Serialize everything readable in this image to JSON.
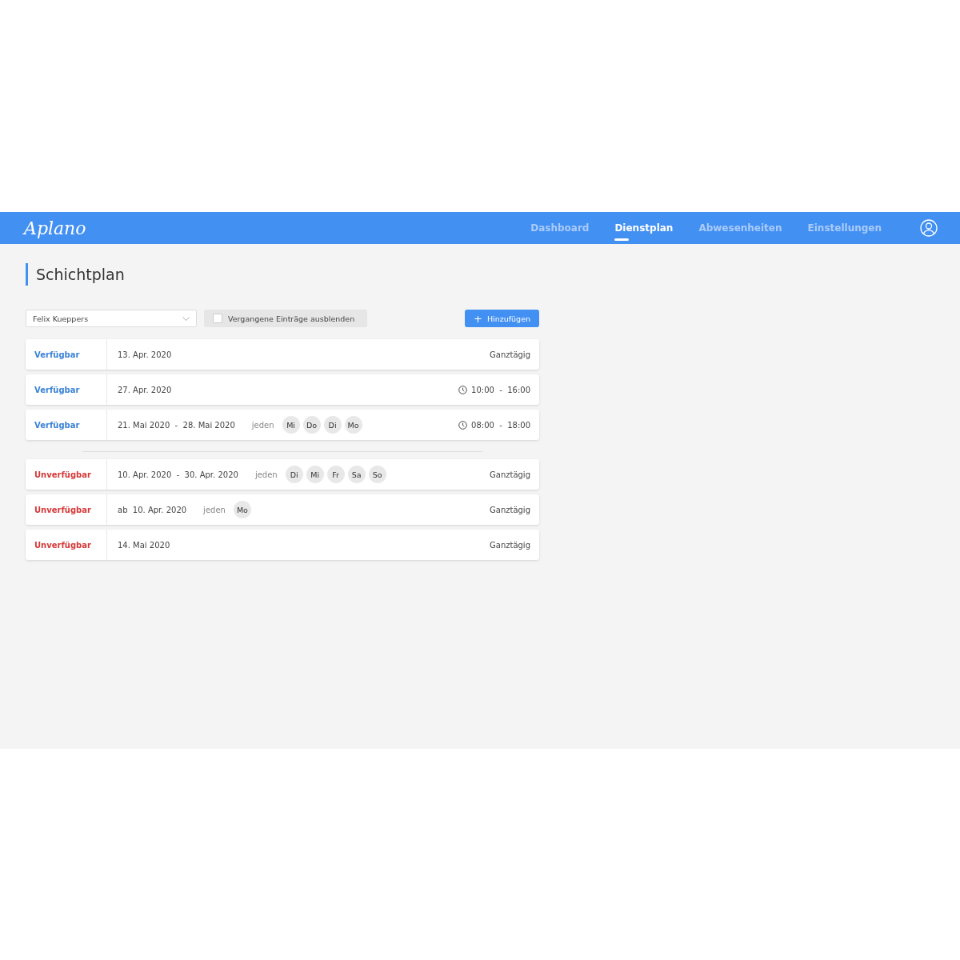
{
  "header": {
    "logo": "Aplano",
    "nav": [
      {
        "label": "Dashboard",
        "selected": false
      },
      {
        "label": "Dienstplan",
        "selected": true
      },
      {
        "label": "Abwesenheiten",
        "selected": false
      },
      {
        "label": "Einstellungen",
        "selected": false
      }
    ]
  },
  "page": {
    "title": "Schichtplan"
  },
  "toolbar": {
    "employee_select": "Felix Kueppers",
    "hide_past": {
      "label": "Vergangene Einträge ausblenden",
      "checked": false
    },
    "add_button": {
      "icon": "+",
      "label": "Hinzufügen"
    }
  },
  "groups": [
    {
      "entries": [
        {
          "status": "Verfügbar",
          "kind": "available",
          "date": "13. Apr. 2020",
          "time": {
            "text": "Ganztägig",
            "clock": false
          }
        },
        {
          "status": "Verfügbar",
          "kind": "available",
          "date": "27. Apr. 2020",
          "time": {
            "text": "10:00  -  16:00",
            "clock": true
          }
        },
        {
          "status": "Verfügbar",
          "kind": "available",
          "date": "21. Mai 2020  -  28. Mai 2020",
          "repeat": "jeden",
          "days": [
            "Mi",
            "Do",
            "Di",
            "Mo"
          ],
          "time": {
            "text": "08:00  -  18:00",
            "clock": true
          }
        }
      ]
    },
    {
      "entries": [
        {
          "status": "Unverfügbar",
          "kind": "unavailable",
          "date": "10. Apr. 2020  -  30. Apr. 2020",
          "repeat": "jeden",
          "days": [
            "Di",
            "Mi",
            "Fr",
            "Sa",
            "So"
          ],
          "time": {
            "text": "Ganztägig",
            "clock": false
          }
        },
        {
          "status": "Unverfügbar",
          "kind": "unavailable",
          "date": "ab  10. Apr. 2020",
          "repeat": "jeden",
          "days": [
            "Mo"
          ],
          "time": {
            "text": "Ganztägig",
            "clock": false
          }
        },
        {
          "status": "Unverfügbar",
          "kind": "unavailable",
          "date": "14. Mai 2020",
          "time": {
            "text": "Ganztägig",
            "clock": false
          }
        }
      ]
    }
  ]
}
